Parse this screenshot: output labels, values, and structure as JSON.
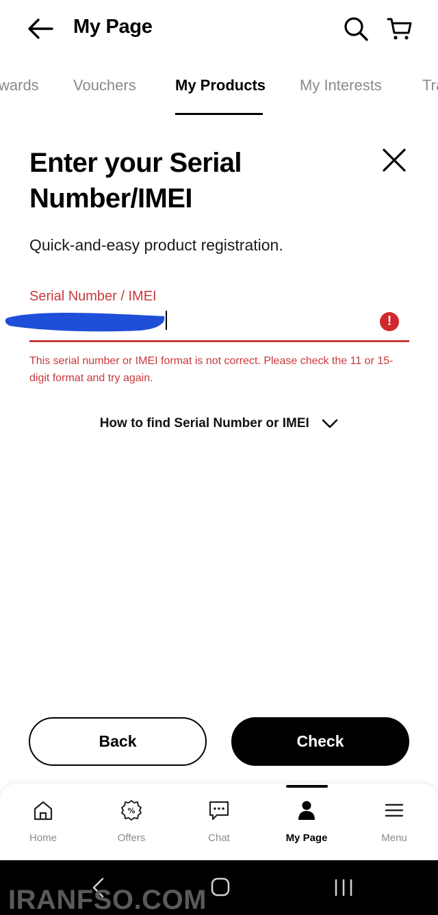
{
  "header": {
    "title": "My Page",
    "back_icon": "back-arrow-icon",
    "search_icon": "search-icon",
    "cart_icon": "cart-icon"
  },
  "tabs": [
    {
      "label": "wards",
      "active": false
    },
    {
      "label": "Vouchers",
      "active": false
    },
    {
      "label": "My Products",
      "active": true
    },
    {
      "label": "My Interests",
      "active": false
    },
    {
      "label": "Tra",
      "active": false
    }
  ],
  "dialog": {
    "heading": "Enter your Serial Number/IMEI",
    "subtitle": "Quick-and-easy product registration.",
    "field": {
      "label": "Serial Number / IMEI",
      "value": "",
      "error": "This serial number or IMEI format is not correct. Please check the 11 or 15-digit format and try again.",
      "error_icon": "!"
    },
    "howto_label": "How to find Serial Number or IMEI",
    "back_label": "Back",
    "check_label": "Check"
  },
  "bottom_nav": [
    {
      "label": "Home",
      "icon": "home-icon",
      "active": false
    },
    {
      "label": "Offers",
      "icon": "offers-icon",
      "active": false
    },
    {
      "label": "Chat",
      "icon": "chat-icon",
      "active": false
    },
    {
      "label": "My Page",
      "icon": "person-icon",
      "active": true
    },
    {
      "label": "Menu",
      "icon": "menu-icon",
      "active": false
    }
  ],
  "watermark": "IRANFSO.COM",
  "colors": {
    "error": "#c8383b",
    "error_icon": "#d0292d",
    "redaction": "#1f4fd8",
    "inactive_text": "#8a8a8a"
  }
}
